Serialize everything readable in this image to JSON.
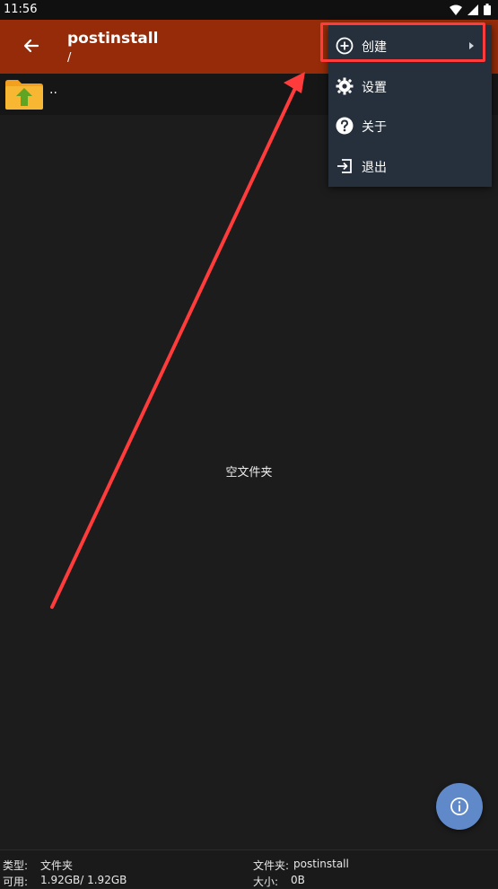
{
  "status_bar": {
    "time": "11:56"
  },
  "header": {
    "title": "postinstall",
    "path": "/"
  },
  "file_list": {
    "parent_entry": ".."
  },
  "empty_message": "空文件夹",
  "menu": {
    "items": [
      {
        "label": "创建",
        "icon": "plus-circle-icon",
        "has_submenu": true
      },
      {
        "label": "设置",
        "icon": "gear-icon"
      },
      {
        "label": "关于",
        "icon": "question-circle-icon"
      },
      {
        "label": "退出",
        "icon": "exit-icon"
      }
    ]
  },
  "footer": {
    "type_label": "类型:",
    "type_value": "文件夹",
    "available_label": "可用:",
    "available_value": "1.92GB/ 1.92GB",
    "folder_label": "文件夹:",
    "folder_value": "postinstall",
    "size_label": "大小:",
    "size_value": "0B"
  },
  "colors": {
    "app_bar": "#952b09",
    "menu_bg": "#26303d",
    "fab": "#5f89c9",
    "highlight": "#ff3b3b",
    "background": "#1c1c1c"
  }
}
